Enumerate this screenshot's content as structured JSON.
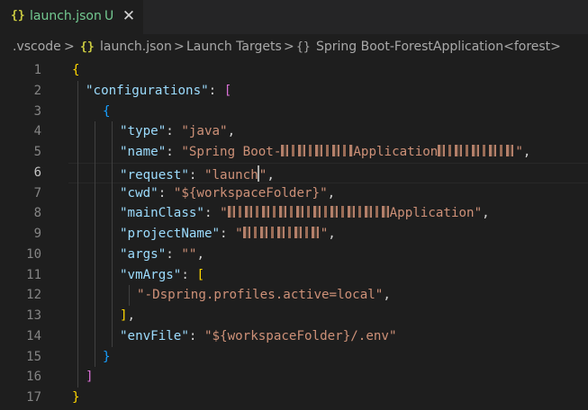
{
  "tab": {
    "icon": "json-braces-icon",
    "icon_text": "{}",
    "name": "launch.json",
    "status": "U",
    "close": "✕"
  },
  "breadcrumb": {
    "items": [
      ".vscode",
      "launch.json",
      "Launch Targets",
      "Spring Boot-ForestApplication<forest>"
    ],
    "separator": ">",
    "icon_text": "{}"
  },
  "editor": {
    "line_numbers": [
      "1",
      "2",
      "3",
      "4",
      "5",
      "6",
      "7",
      "8",
      "9",
      "10",
      "11",
      "12",
      "13",
      "14",
      "15",
      "16",
      "17"
    ],
    "active_line": "6",
    "lines": [
      [
        {
          "t": "{",
          "c": "gold"
        }
      ],
      [
        {
          "t": "\"configurations\"",
          "c": "key"
        },
        {
          "t": ": ",
          "c": "punc"
        },
        {
          "t": "[",
          "c": "pink"
        }
      ],
      [
        {
          "t": "{",
          "c": "blue"
        }
      ],
      [
        {
          "t": "\"type\"",
          "c": "key"
        },
        {
          "t": ": ",
          "c": "punc"
        },
        {
          "t": "\"java\"",
          "c": "str"
        },
        {
          "t": ",",
          "c": "punc"
        }
      ],
      [
        {
          "t": "\"name\"",
          "c": "key"
        },
        {
          "t": ": ",
          "c": "punc"
        },
        {
          "t": "\"Spring Boot-",
          "c": "str"
        },
        {
          "t": "REDACT_A",
          "c": "redact"
        },
        {
          "t": "Application",
          "c": "str"
        },
        {
          "t": "REDACT_B",
          "c": "redact"
        },
        {
          "t": "\"",
          "c": "str"
        },
        {
          "t": ",",
          "c": "punc"
        }
      ],
      [
        {
          "t": "\"request\"",
          "c": "key"
        },
        {
          "t": ": ",
          "c": "punc"
        },
        {
          "t": "\"launch",
          "c": "str"
        },
        {
          "t": "CURSOR",
          "c": "cursor"
        },
        {
          "t": "\"",
          "c": "str"
        },
        {
          "t": ",",
          "c": "punc"
        }
      ],
      [
        {
          "t": "\"cwd\"",
          "c": "key"
        },
        {
          "t": ": ",
          "c": "punc"
        },
        {
          "t": "\"${workspaceFolder}\"",
          "c": "str"
        },
        {
          "t": ",",
          "c": "punc"
        }
      ],
      [
        {
          "t": "\"mainClass\"",
          "c": "key"
        },
        {
          "t": ": ",
          "c": "punc"
        },
        {
          "t": "\"",
          "c": "str"
        },
        {
          "t": "REDACT_C",
          "c": "redact"
        },
        {
          "t": "Application\"",
          "c": "str"
        },
        {
          "t": ",",
          "c": "punc"
        }
      ],
      [
        {
          "t": "\"projectName\"",
          "c": "key"
        },
        {
          "t": ": ",
          "c": "punc"
        },
        {
          "t": "\"",
          "c": "str"
        },
        {
          "t": "REDACT_D",
          "c": "redact"
        },
        {
          "t": "\"",
          "c": "str"
        },
        {
          "t": ",",
          "c": "punc"
        }
      ],
      [
        {
          "t": "\"args\"",
          "c": "key"
        },
        {
          "t": ": ",
          "c": "punc"
        },
        {
          "t": "\"\"",
          "c": "str"
        },
        {
          "t": ",",
          "c": "punc"
        }
      ],
      [
        {
          "t": "\"vmArgs\"",
          "c": "key"
        },
        {
          "t": ": ",
          "c": "punc"
        },
        {
          "t": "[",
          "c": "gold"
        }
      ],
      [
        {
          "t": "\"-Dspring.profiles.active=local\"",
          "c": "str"
        },
        {
          "t": ",",
          "c": "punc"
        }
      ],
      [
        {
          "t": "]",
          "c": "gold"
        },
        {
          "t": ",",
          "c": "punc"
        }
      ],
      [
        {
          "t": "\"envFile\"",
          "c": "key"
        },
        {
          "t": ": ",
          "c": "punc"
        },
        {
          "t": "\"${workspaceFolder}/.env\"",
          "c": "str"
        }
      ],
      [
        {
          "t": "}",
          "c": "blue"
        }
      ],
      [
        {
          "t": "]",
          "c": "pink"
        }
      ],
      [
        {
          "t": "}",
          "c": "gold"
        }
      ]
    ]
  }
}
